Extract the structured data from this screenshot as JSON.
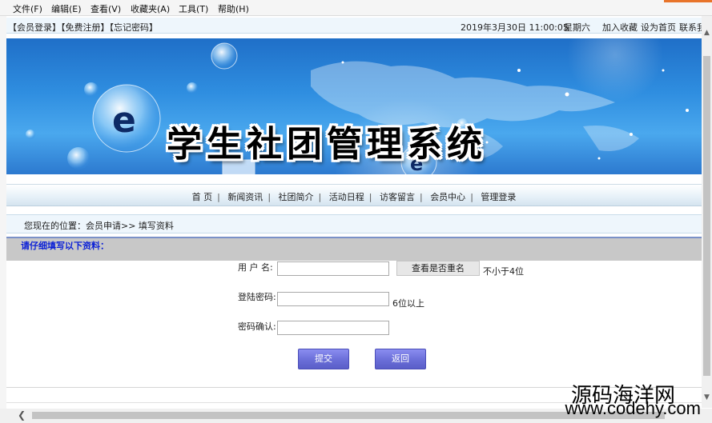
{
  "menu": {
    "items": [
      "文件(F)",
      "编辑(E)",
      "查看(V)",
      "收藏夹(A)",
      "工具(T)",
      "帮助(H)"
    ]
  },
  "topbar": {
    "member_links": "【会员登录】【免费注册】【忘记密码】",
    "datetime": "2019年3月30日  11:00:05",
    "weekday": "星期六",
    "favorite": "加入收藏",
    "homepage": "设为首页",
    "contact": "联系我"
  },
  "banner": {
    "title": "学生社团管理系统"
  },
  "nav": {
    "items": [
      "首 页",
      "新闻资讯",
      "社团简介",
      "活动日程",
      "访客留言",
      "会员中心",
      "管理登录"
    ]
  },
  "breadcrumb": "您现在的位置：会员申请>> 填写资料",
  "form": {
    "title": "请仔细填写以下资料：",
    "username_label": "用 户 名:",
    "check_button": "查看是否重名",
    "username_hint": "不小于4位",
    "password_label": "登陆密码:",
    "password_hint": "6位以上",
    "confirm_label": "密码确认:",
    "submit_label": "提交",
    "back_label": "返回"
  },
  "watermark": {
    "line1": "源码海洋网",
    "line2": "www.codehy.com"
  },
  "colors": {
    "form_title_text": "#0a1fd6",
    "button_blue": "#6a6ed8",
    "banner_blue": "#2f8ee0"
  }
}
